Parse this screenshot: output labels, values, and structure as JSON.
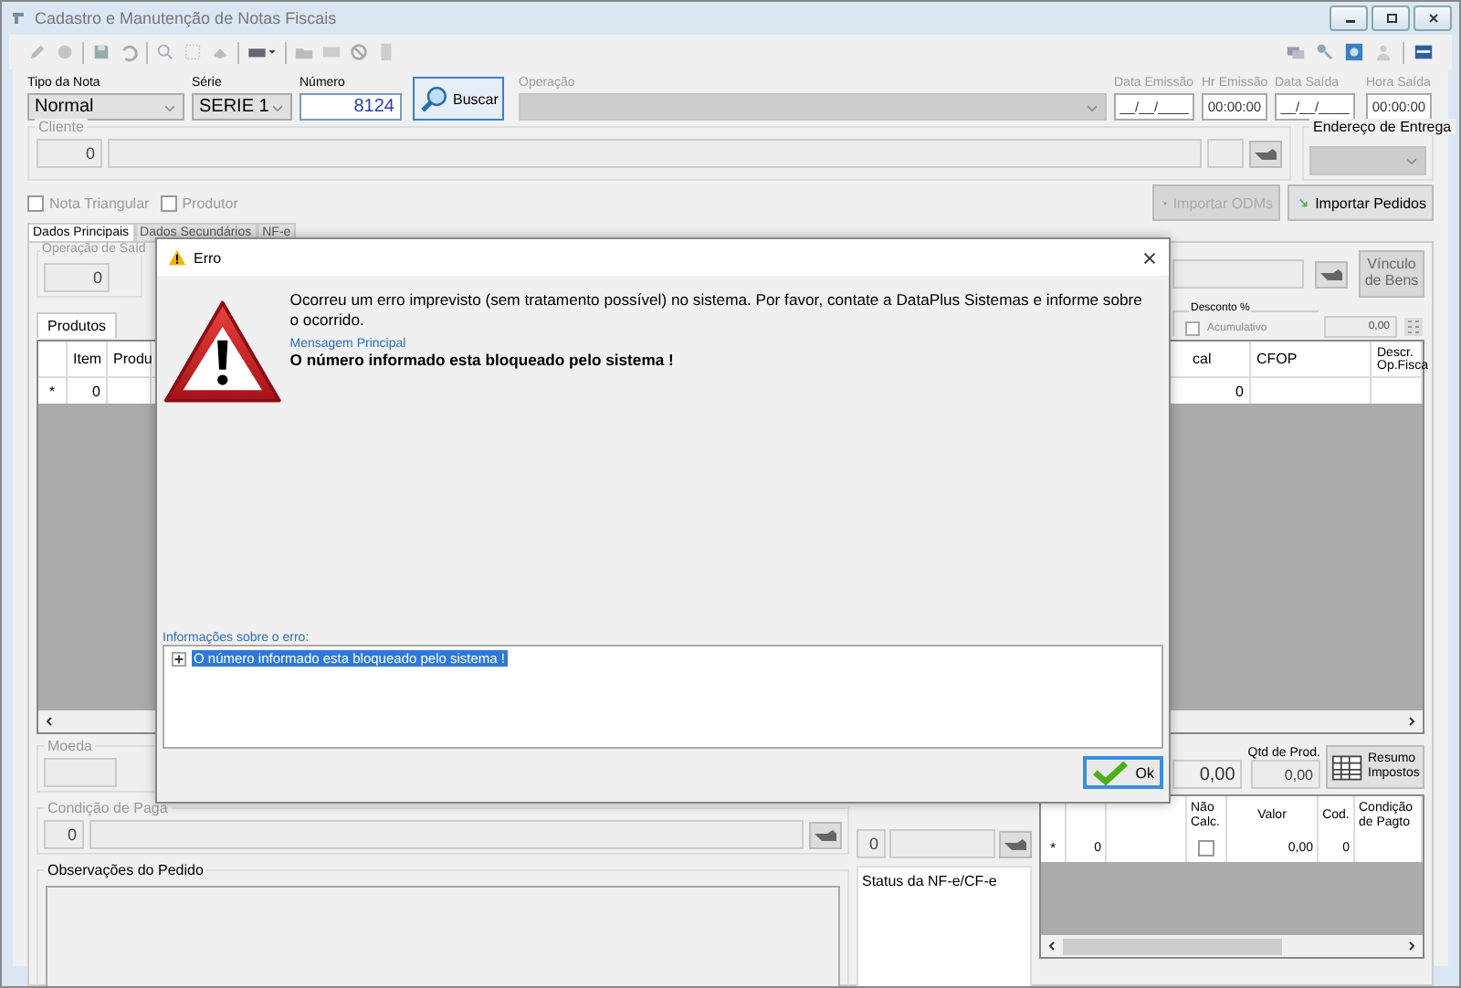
{
  "window": {
    "title": "Cadastro e Manutenção de Notas Fiscais"
  },
  "header_fields": [
    {
      "kind": "select",
      "label": "Tipo da Nota",
      "value": "Normal",
      "disabled": false
    },
    {
      "kind": "select",
      "label": "Série",
      "value": "SERIE 1",
      "disabled": false
    },
    {
      "kind": "input",
      "label": "Número",
      "value": "8124",
      "disabled": false
    },
    {
      "kind": "button",
      "label": "Buscar",
      "disabled": false
    },
    {
      "kind": "select",
      "label": "Operação",
      "disabled": true
    },
    {
      "kind": "input",
      "label": "Data Emissão",
      "value": "__/__/____",
      "disabled": true
    },
    {
      "kind": "input",
      "label": "Hr Emissão",
      "value": "00:00:00",
      "disabled": true
    },
    {
      "kind": "input",
      "label": "Data Saída",
      "value": "__/__/____",
      "disabled": true
    },
    {
      "kind": "input",
      "label": "Hora Saída",
      "value": "00:00:00",
      "disabled": true
    }
  ],
  "cliente": {
    "label": "Cliente",
    "code": "0"
  },
  "endereco_entrega": {
    "label": "Endereço de Entrega"
  },
  "options": [
    {
      "label": "Nota Triangular",
      "checked": false
    },
    {
      "label": "Produtor",
      "checked": false
    }
  ],
  "import_buttons": [
    {
      "label": "Importar ODMs",
      "disabled": true
    },
    {
      "label": "Importar Pedidos",
      "disabled": false
    }
  ],
  "tabs": [
    {
      "label": "Dados Principais",
      "selected": true
    },
    {
      "label": "Dados Secundários",
      "selected": false
    },
    {
      "label": "NF-e",
      "selected": false
    }
  ],
  "operacao_saida": {
    "label": "Operação de Saíd",
    "code": "0"
  },
  "vinculo_button": "Vínculo de Bens",
  "desconto": {
    "label": "Desconto %",
    "acumulativo": {
      "label": "Acumulativo",
      "checked": false
    },
    "value": "0,00"
  },
  "product_tabs": [
    {
      "label": "Produtos",
      "selected": true
    }
  ],
  "products_table": {
    "columns_left": [
      "Item",
      "Produ"
    ],
    "columns_right": [
      "cal",
      "CFOP",
      "Descr. Op.Fisca"
    ],
    "row": {
      "marker": "*",
      "item": "0",
      "cal": "0"
    }
  },
  "moeda": {
    "label": "Moeda"
  },
  "condicao": {
    "label": "Condição de Paga",
    "code": "0"
  },
  "middle_code": "0",
  "observacoes": {
    "label": "Observações do Pedido"
  },
  "status": {
    "label": "Status da NF-e/CF-e"
  },
  "totals": {
    "value": "0,00",
    "qtd_label": "Qtd de Prod.",
    "qtd_value": "0,00",
    "resumo_button": "Resumo Impostos"
  },
  "payments_table": {
    "columns": [
      "Não Calc.",
      "Valor",
      "Cod.",
      "Condição de Pagto"
    ],
    "row": {
      "marker": "*",
      "prazo": "0",
      "nao_calc": false,
      "valor": "0,00",
      "cod": "0"
    }
  },
  "dialog": {
    "title": "Erro",
    "message": "Ocorreu um erro imprevisto (sem tratamento possível) no sistema. Por favor, contate a DataPlus Sistemas e informe sobre o ocorrido.",
    "main_label": "Mensagem Principal",
    "main_message": "O número informado esta bloqueado pelo sistema !",
    "details_label": "Informações sobre o erro:",
    "details": [
      {
        "text": "O número informado esta bloqueado pelo sistema !",
        "selected": true
      }
    ],
    "ok": "Ok"
  }
}
